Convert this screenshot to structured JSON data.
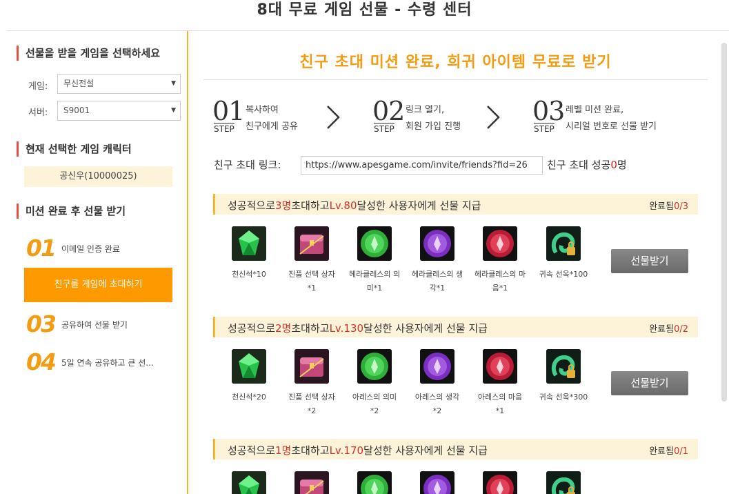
{
  "page_title": "8대 무료 게임 선물 - 수령 센터",
  "sidebar": {
    "select_title": "선물을 받을 게임을 선택하세요",
    "game_label": "게임:",
    "game_value": "무신전설",
    "server_label": "서버:",
    "server_value": "S9001",
    "char_title": "현재 선택한 게임 캐릭터",
    "char_value": "공신우(10000025)",
    "mission_title": "미션 완료 후 선물 받기",
    "steps": [
      {
        "num": "01",
        "text": "이메일 인증 완료"
      },
      {
        "num": "02",
        "text": "친구를 게임에 초대하기"
      },
      {
        "num": "03",
        "text": "공유하여 선물 받기"
      },
      {
        "num": "04",
        "text": "5일 연속 공유하고 큰 선..."
      }
    ]
  },
  "main": {
    "heading": "친구 초대 미션 완료, 희귀 아이템 무료로 받기",
    "step_label": "STEP",
    "steps": [
      {
        "num": "01",
        "line1": "복사하여",
        "line2": "친구에게 공유"
      },
      {
        "num": "02",
        "line1": "링크 열기,",
        "line2": "회원 가입 진행"
      },
      {
        "num": "03",
        "line1": "레벨 미션 완료,",
        "line2": "시리얼 번호로 선물 받기"
      }
    ],
    "invite_link_label": "친구 초대 링크:",
    "invite_link_value": "https://www.apesgame.com/invite/friends?fid=26",
    "success_prefix": "친구 초대 성공",
    "success_count": "0",
    "success_suffix": "명"
  },
  "tiers": [
    {
      "pre": "성공적으로",
      "count": "3명",
      "mid": "초대하고",
      "level": "Lv.80",
      "post": "달성한 사용자에게 선물 지급",
      "done_label": "완료됨",
      "done_value": "0/3",
      "button": "선물받기",
      "items": [
        {
          "icon": "green-gem-icon",
          "name": "천신석*10"
        },
        {
          "icon": "treasure-chest-icon",
          "name": "진품 선택 상자 *1"
        },
        {
          "icon": "green-orb-icon",
          "name": "헤라클레스의 의미*1"
        },
        {
          "icon": "purple-orb-icon",
          "name": "헤라클레스의 생각*1"
        },
        {
          "icon": "red-orb-icon",
          "name": "헤라클레스의 마음*1"
        },
        {
          "icon": "jade-lock-icon",
          "name": "귀속 선옥*100"
        }
      ]
    },
    {
      "pre": "성공적으로",
      "count": "2명",
      "mid": "초대하고",
      "level": "Lv.130",
      "post": "달성한 사용자에게 선물 지급",
      "done_label": "완료됨",
      "done_value": "0/2",
      "button": "선물받기",
      "items": [
        {
          "icon": "green-gem-icon",
          "name": "천신석*20"
        },
        {
          "icon": "treasure-chest-icon",
          "name": "진품 선택 상자 *2"
        },
        {
          "icon": "green-orb-icon",
          "name": "아레스의 의미 *2"
        },
        {
          "icon": "purple-orb-icon",
          "name": "아레스의 생각 *2"
        },
        {
          "icon": "red-orb-icon",
          "name": "아레스의 마음 *1"
        },
        {
          "icon": "jade-lock-icon",
          "name": "귀속 선옥*300"
        }
      ]
    },
    {
      "pre": "성공적으로",
      "count": "1명",
      "mid": "초대하고",
      "level": "Lv.170",
      "post": "달성한 사용자에게 선물 지급",
      "done_label": "완료됨",
      "done_value": "0/1",
      "button": "",
      "items": [
        {
          "icon": "green-gem-icon",
          "name": ""
        },
        {
          "icon": "treasure-chest-icon",
          "name": ""
        },
        {
          "icon": "green-orb-icon",
          "name": ""
        },
        {
          "icon": "purple-orb-icon",
          "name": ""
        },
        {
          "icon": "red-orb-icon",
          "name": ""
        },
        {
          "icon": "jade-lock-icon",
          "name": ""
        }
      ]
    }
  ],
  "colors": {
    "accent": "#f39c12",
    "orange_button": "#ff9900",
    "band_bg": "#fdf3d8",
    "highlight_red": "#d0332a",
    "claim_button": "#777777"
  }
}
